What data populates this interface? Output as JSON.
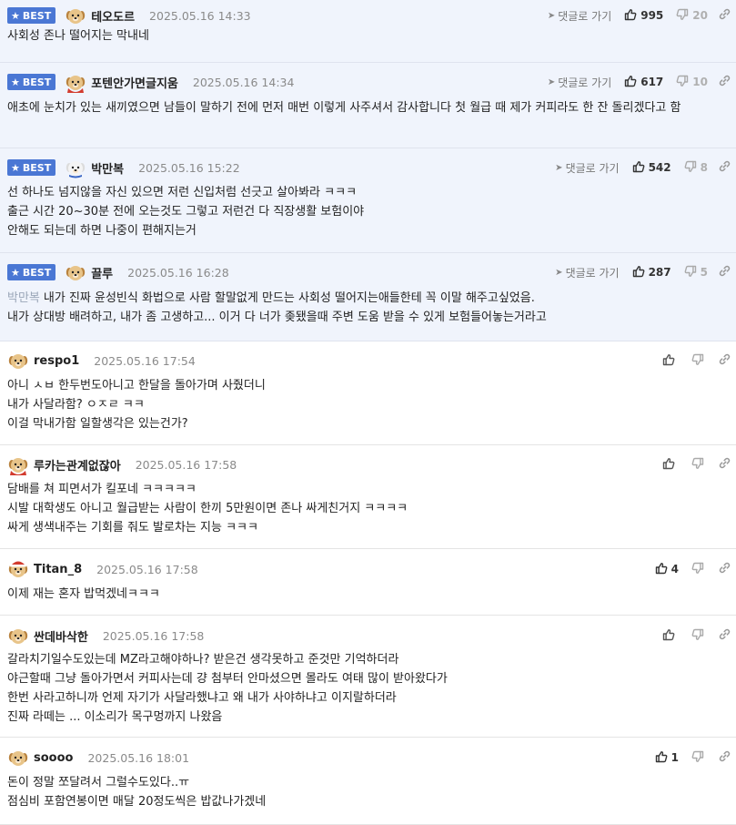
{
  "best_label": "BEST",
  "reply_link_label": "댓글로 가기",
  "comments": [
    {
      "best": true,
      "avatar": "puppy",
      "nick": "테오도르",
      "date": "2025.05.16 14:33",
      "up": "995",
      "down": "20",
      "lines": [
        {
          "text": "사회성 존나 떨어지는 막내네"
        }
      ]
    },
    {
      "best": true,
      "avatar": "puppy-cape",
      "nick": "포텐안가면글지움",
      "date": "2025.05.16 14:34",
      "up": "617",
      "down": "10",
      "lines": [
        {
          "text": "애초에 눈치가 있는 새끼였으면 남들이 말하기 전에 먼저 매번 이렇게 사주셔서 감사합니다 첫 월급 때 제가 커피라도 한 잔 돌리겠다고 함"
        }
      ]
    },
    {
      "best": true,
      "avatar": "white-dog",
      "nick": "박만복",
      "date": "2025.05.16 15:22",
      "up": "542",
      "down": "8",
      "lines": [
        {
          "text": "선 하나도 넘지않을 자신 있으면 저런 신입처럼 선긋고 살아봐라 ㅋㅋㅋ"
        },
        {
          "text": "출근 시간 20~30분 전에 오는것도 그렇고 저런건 다 직장생활 보험이야"
        },
        {
          "text": "안해도 되는데 하면 나중이 편해지는거"
        }
      ]
    },
    {
      "best": true,
      "avatar": "puppy",
      "nick": "끌루",
      "date": "2025.05.16 16:28",
      "up": "287",
      "down": "5",
      "lines": [
        {
          "mention": "박만복",
          "text": "내가 진짜 윤성빈식 화법으로 사람 할말없게 만드는 사회성 떨어지는애들한테 꼭 이말 해주고싶었음."
        },
        {
          "text": "내가 상대방 배려하고, 내가 좀 고생하고... 이거 다 너가 좆됐을때 주변 도움 받을 수 있게 보험들어놓는거라고"
        }
      ]
    },
    {
      "best": false,
      "avatar": "puppy",
      "nick": "respo1",
      "date": "2025.05.16 17:54",
      "up": "",
      "down": "",
      "lines": [
        {
          "text": "아니 ㅅㅂ 한두번도아니고 한달을 돌아가며 사줬더니"
        },
        {
          "text": "내가 사달라함? ㅇㅈㄹ ㅋㅋ"
        },
        {
          "text": "이걸 막내가함 일할생각은 있는건가?"
        }
      ]
    },
    {
      "best": false,
      "avatar": "puppy-cape",
      "nick": "루카는관계없잖아",
      "date": "2025.05.16 17:58",
      "up": "",
      "down": "",
      "lines": [
        {
          "text": "담배를 쳐 피면서가 킬포네 ㅋㅋㅋㅋㅋ"
        },
        {
          "text": "시발 대학생도 아니고 월급받는 사람이 한끼 5만원이면 존나 싸게친거지 ㅋㅋㅋㅋ"
        },
        {
          "text": "싸게 생색내주는 기회를 줘도 발로차는 지능 ㅋㅋㅋ"
        }
      ]
    },
    {
      "best": false,
      "avatar": "puppy-hat",
      "nick": "Titan_8",
      "date": "2025.05.16 17:58",
      "up": "4",
      "down": "",
      "lines": [
        {
          "text": "이제 재는 혼자 밥먹겠네ㅋㅋㅋ"
        }
      ]
    },
    {
      "best": false,
      "avatar": "puppy",
      "nick": "싼데바삭한",
      "date": "2025.05.16 17:58",
      "up": "",
      "down": "",
      "lines": [
        {
          "text": "갈라치기일수도있는데 MZ라고해야하나? 받은건 생각못하고 준것만 기억하더라"
        },
        {
          "text": "야근할때 그냥 돌아가면서 커피사는데 걍 첨부터 안마셨으면 몰라도 여태 많이 받아왔다가"
        },
        {
          "text": "한번 사라고하니까 언제 자기가 사달라했냐고 왜 내가 사야하냐고 이지랄하더라"
        },
        {
          "text": "진짜 라떼는 ... 이소리가 목구멍까지 나왔음"
        }
      ]
    },
    {
      "best": false,
      "avatar": "puppy",
      "nick": "soooo",
      "date": "2025.05.16 18:01",
      "up": "1",
      "down": "",
      "lines": [
        {
          "text": "돈이 정말 쪼달려서 그럴수도있다..ㅠ"
        },
        {
          "text": "점심비 포함연봉이면 매달 20정도씩은 밥값나가겠네"
        }
      ]
    }
  ]
}
